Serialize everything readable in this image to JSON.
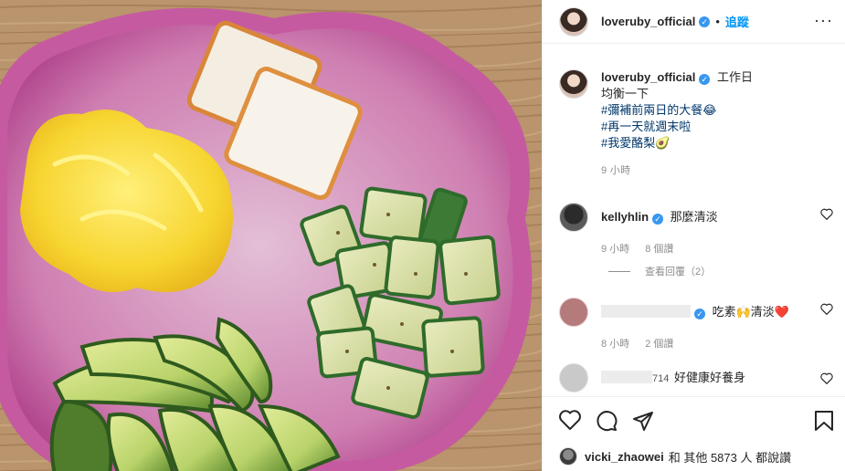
{
  "post": {
    "username": "loveruby_official",
    "follow_label": "追蹤",
    "more_label": "···"
  },
  "caption": {
    "username": "loveruby_official",
    "line1": "工作日",
    "line2": "均衡一下",
    "hashtag1": "#彌補前兩日的大餐😂",
    "hashtag2": "#再一天就週末啦",
    "hashtag3": "#我愛酪梨🥑",
    "time": "9 小時"
  },
  "comments": [
    {
      "username": "kellyhlin",
      "text": "那麼清淡",
      "time": "9 小時",
      "likes": "8 個讚"
    },
    {
      "username": "",
      "text": "吃素🙌清淡❤️",
      "time": "8 小時",
      "likes": "2 個讚"
    },
    {
      "username": "714",
      "text": "好健康好養身"
    }
  ],
  "replies": {
    "label": "查看回覆（2）"
  },
  "likes_summary": {
    "username": "vicki_zhaowei",
    "rest": "和 其他 5873 人 都說讚"
  },
  "colors": {
    "follow_blue": "#0095f6",
    "verified_blue": "#3897f0",
    "muted": "#8e8e8e",
    "hashtag": "#00376b"
  },
  "icons": [
    "verified-badge-icon",
    "more-options-icon",
    "heart-icon",
    "comment-icon",
    "share-icon",
    "bookmark-icon"
  ]
}
